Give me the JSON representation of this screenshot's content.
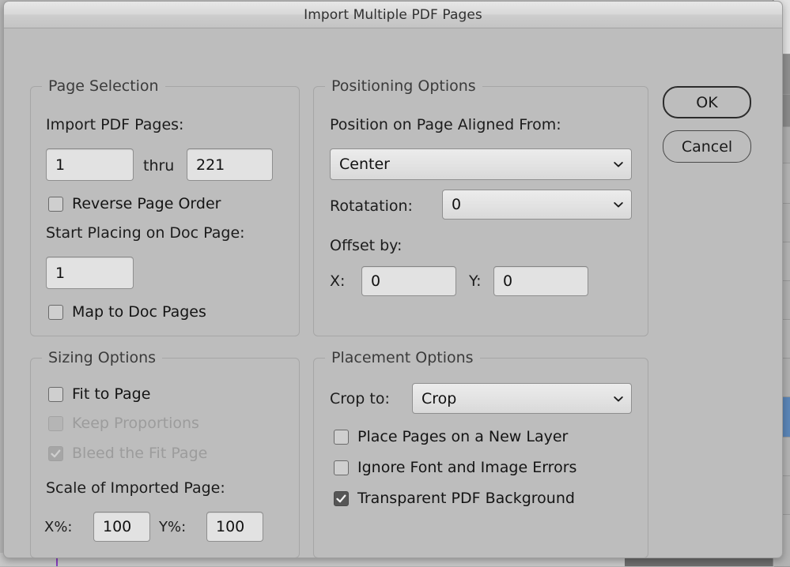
{
  "window": {
    "title": "Import Multiple PDF Pages"
  },
  "buttons": {
    "ok": "OK",
    "cancel": "Cancel"
  },
  "page_selection": {
    "title": "Page Selection",
    "import_pdf_pages_label": "Import PDF Pages:",
    "from_value": "1",
    "thru_label": "thru",
    "to_value": "221",
    "reverse_page_order": {
      "label": "Reverse Page Order",
      "checked": false,
      "disabled": false
    },
    "start_placing_label": "Start Placing on Doc Page:",
    "start_placing_value": "1",
    "map_to_doc_pages": {
      "label": "Map to Doc Pages",
      "checked": false,
      "disabled": false
    }
  },
  "positioning_options": {
    "title": "Positioning Options",
    "position_label": "Position on Page Aligned From:",
    "position_value": "Center",
    "position_options": [
      "Center"
    ],
    "rotatation_label": "Rotatation:",
    "rotatation_value": "0",
    "rotatation_options": [
      "0"
    ],
    "offset_by_label": "Offset by:",
    "offset_x_label": "X:",
    "offset_x_value": "0",
    "offset_y_label": "Y:",
    "offset_y_value": "0"
  },
  "sizing_options": {
    "title": "Sizing Options",
    "fit_to_page": {
      "label": "Fit to Page",
      "checked": false,
      "disabled": false
    },
    "keep_proportions": {
      "label": "Keep Proportions",
      "checked": false,
      "disabled": true
    },
    "bleed_the_fit_page": {
      "label": "Bleed the Fit Page",
      "checked": true,
      "disabled": true
    },
    "scale_label": "Scale of Imported Page:",
    "scale_x_label": "X%:",
    "scale_x_value": "100",
    "scale_y_label": "Y%:",
    "scale_y_value": "100"
  },
  "placement_options": {
    "title": "Placement Options",
    "crop_to_label": "Crop to:",
    "crop_to_value": "Crop",
    "crop_to_options": [
      "Crop"
    ],
    "place_pages_new_layer": {
      "label": "Place Pages on a New Layer",
      "checked": false,
      "disabled": false
    },
    "ignore_font_image_errors": {
      "label": "Ignore Font and Image Errors",
      "checked": false,
      "disabled": false
    },
    "transparent_pdf_background": {
      "label": "Transparent PDF Background",
      "checked": true,
      "disabled": false
    }
  },
  "colors": {
    "dialog_background": "#bdbdbd",
    "titlebar_top": "#e7e7e7",
    "input_background": "#e2e2e2",
    "checkbox_checked": "#565656",
    "accent_selection": "#5b86b8",
    "guide_purple": "#8a3fc0"
  },
  "background": {
    "scrollbar_highlight_color": "#5b86b8"
  }
}
